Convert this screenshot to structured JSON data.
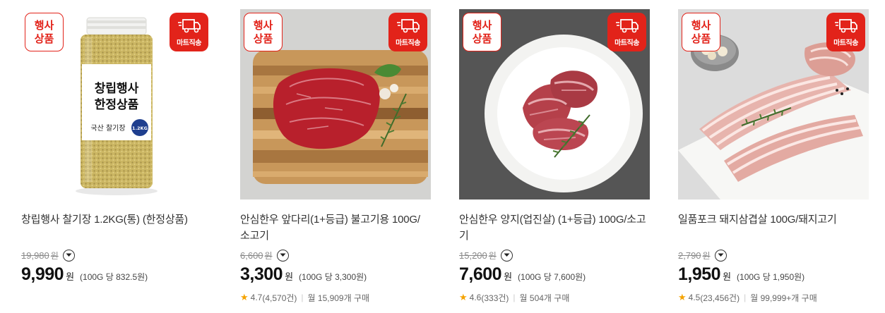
{
  "badges": {
    "event_line1": "행사",
    "event_line2": "상품",
    "delivery": "마트직송"
  },
  "bottle_label": {
    "line1": "창립행사",
    "line2": "한정상품",
    "sub": "국산 찰기장",
    "weight": "1.2KG"
  },
  "products": [
    {
      "title_line1": "창립행사 찰기장 1.2KG(통) (한정상품)",
      "title_line2": "",
      "original_price": "19,980",
      "original_unit": "원",
      "price": "9,990",
      "price_unit": "원",
      "unit_price": "(100G 당 832.5원)",
      "rating": "",
      "reviews": "",
      "monthly": ""
    },
    {
      "title_line1": "안심한우 앞다리(1+등급) 불고기용 100G/",
      "title_line2": "소고기",
      "original_price": "6,600",
      "original_unit": "원",
      "price": "3,300",
      "price_unit": "원",
      "unit_price": "(100G 당 3,300원)",
      "rating": "4.7",
      "reviews": "(4,570건)",
      "monthly": "월 15,909개 구매"
    },
    {
      "title_line1": "안심한우 양지(업진살) (1+등급) 100G/소고",
      "title_line2": "기",
      "original_price": "15,200",
      "original_unit": "원",
      "price": "7,600",
      "price_unit": "원",
      "unit_price": "(100G 당 7,600원)",
      "rating": "4.6",
      "reviews": "(333건)",
      "monthly": "월 504개 구매"
    },
    {
      "title_line1": "일품포크 돼지삼겹살 100G/돼지고기",
      "title_line2": "",
      "original_price": "2,790",
      "original_unit": "원",
      "price": "1,950",
      "price_unit": "원",
      "unit_price": "(100G 당 1,950원)",
      "rating": "4.5",
      "reviews": "(23,456건)",
      "monthly": "월 99,999+개 구매"
    }
  ],
  "colors": {
    "brand_red": "#e2231a",
    "star": "#f5a300"
  }
}
